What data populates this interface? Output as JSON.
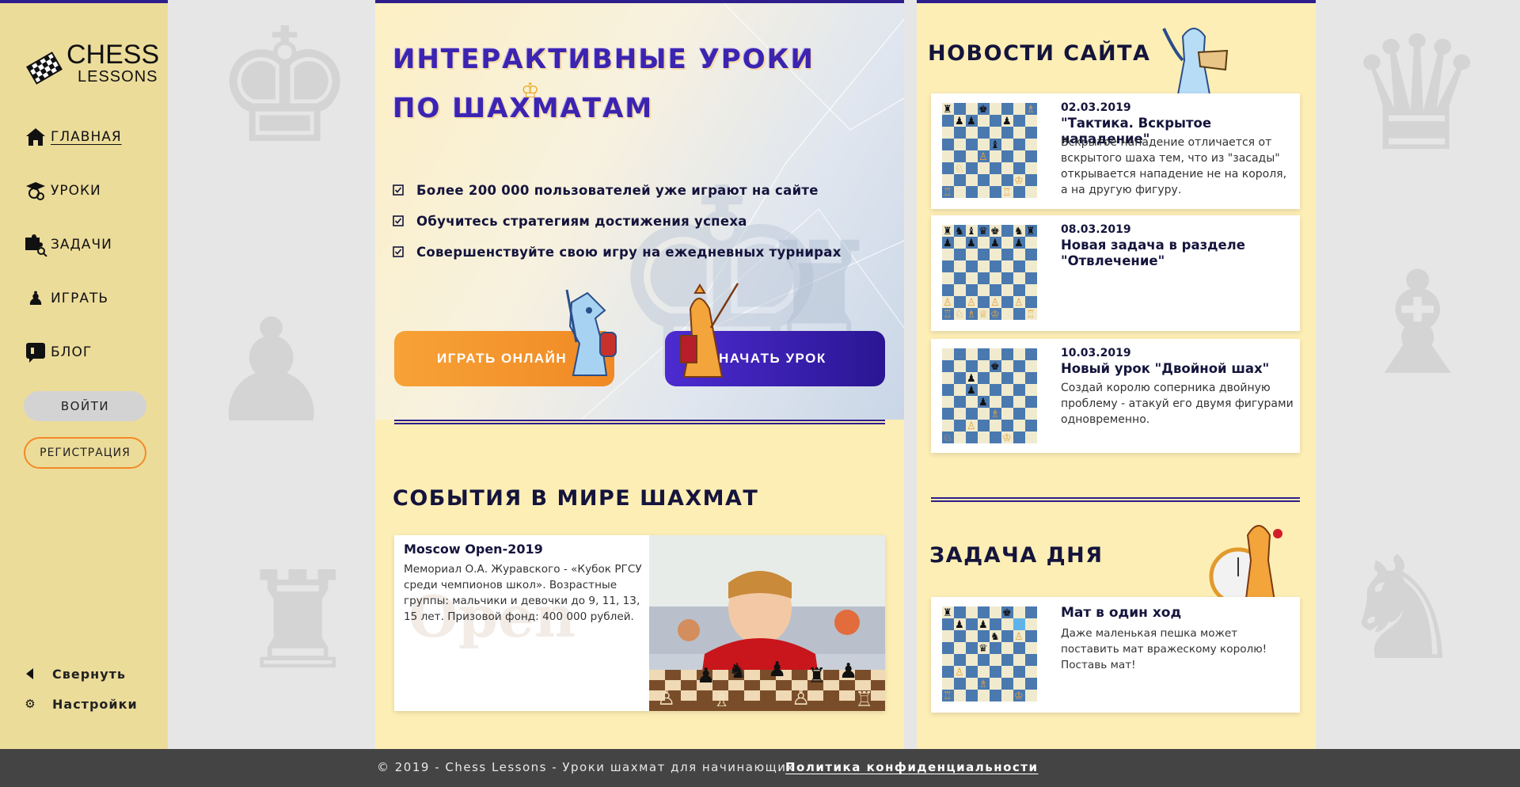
{
  "logo": {
    "line1": "CHESS",
    "line2": "LESSONS"
  },
  "nav": {
    "items": [
      {
        "label": "ГЛАВНАЯ",
        "icon": "home-icon",
        "active": true
      },
      {
        "label": "УРОКИ",
        "icon": "graduation-cap-icon",
        "active": false
      },
      {
        "label": "ЗАДАЧИ",
        "icon": "puzzle-search-icon",
        "active": false
      },
      {
        "label": "ИГРАТЬ",
        "icon": "pawn-icon",
        "active": false
      },
      {
        "label": "БЛОГ",
        "icon": "blog-icon",
        "active": false
      }
    ],
    "login_label": "ВОЙТИ",
    "register_label": "РЕГИСТРАЦИЯ",
    "collapse_label": "Свернуть",
    "settings_label": "Настройки"
  },
  "hero": {
    "title_line1": "ИНТЕРАКТИВНЫЕ УРОКИ",
    "title_line2": "ПО ШАХМАТАМ",
    "bullets": [
      "Более 200 000 пользователей уже играют на сайте",
      "Обучитесь стратегиям достижения успеха",
      "Совершенствуйте свою игру на ежедневных турнирах"
    ],
    "play_label": "ИГРАТЬ ОНЛАЙН",
    "start_label": "НАЧАТЬ УРОК"
  },
  "events": {
    "title": "СОБЫТИЯ В МИРЕ ШАХМАТ",
    "card": {
      "title": "Moscow Open-2019",
      "desc": "Мемориал О.А. Журавского - «Кубок РГСУ среди чемпионов школ». Возрастные группы: мальчики и девочки до 9, 11, 13, 15 лет. Призовой фонд: 400 000 рублей.",
      "watermark": "Open"
    }
  },
  "news": {
    "title": "НОВОСТИ САЙТА",
    "items": [
      {
        "date": "02.03.2019",
        "title": "\"Тактика. Вскрытое нападение\"",
        "desc": "Вскрытое нападение отличается от вскрытого шаха тем, что из \"засады\" открывается нападение не на короля, а на другую фигуру."
      },
      {
        "date": "08.03.2019",
        "title": "Новая задача в разделе \"Отвлечение\"",
        "desc": ""
      },
      {
        "date": "10.03.2019",
        "title": "Новый урок \"Двойной шах\"",
        "desc": "Создай королю соперника двойную проблему - атакуй его двумя фигурами одновременно."
      }
    ]
  },
  "puzzle": {
    "section_title": "ЗАДАЧА ДНЯ",
    "title": "Мат в один ход",
    "desc": "Даже маленькая пешка может поставить мат вражескому королю! Поставь мат!"
  },
  "footer": {
    "copyright": "© 2019 - Chess Lessons - Уроки шахмат для начинающих",
    "privacy": "Политика конфиденциальности"
  },
  "colors": {
    "accent_purple": "#2e1e8c",
    "accent_orange": "#f28a26",
    "panel_yellow": "#fdeeb5",
    "sidebar_yellow": "#ecdc9a",
    "footer_gray": "#444444"
  }
}
